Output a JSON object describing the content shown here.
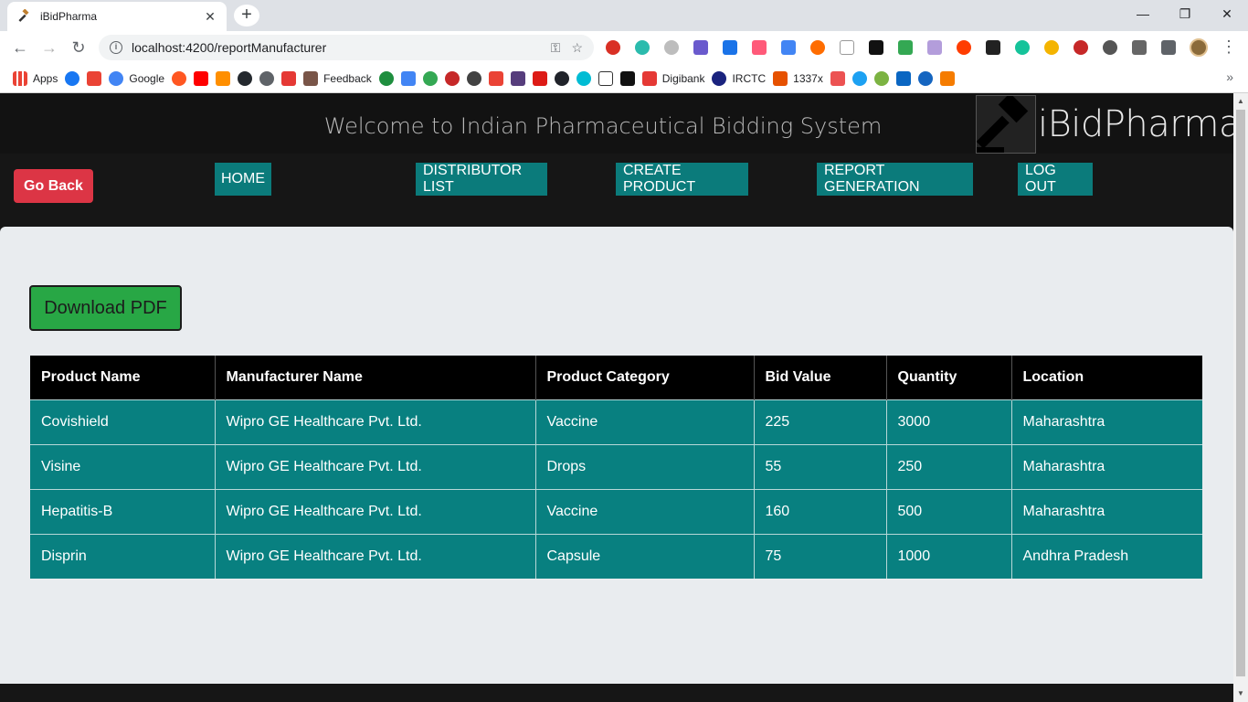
{
  "browser": {
    "tab_title": "iBidPharma",
    "url": "localhost:4200/reportManufacturer",
    "bookmarks": [
      "Apps",
      "Google",
      "Feedback",
      "Digibank",
      "IRCTC",
      "1337x"
    ]
  },
  "header": {
    "welcome": "Welcome to Indian Pharmaceutical Bidding System",
    "brand": "iBidPharma"
  },
  "nav": {
    "go_back": "Go Back",
    "links": [
      "HOME",
      "DISTRIBUTOR LIST",
      "CREATE PRODUCT",
      "REPORT GENERATION",
      "LOG OUT"
    ]
  },
  "main": {
    "download_pdf": "Download PDF",
    "table": {
      "headers": [
        "Product Name",
        "Manufacturer Name",
        "Product Category",
        "Bid Value",
        "Quantity",
        "Location"
      ],
      "rows": [
        [
          "Covishield",
          "Wipro GE Healthcare Pvt. Ltd.",
          "Vaccine",
          "225",
          "3000",
          "Maharashtra"
        ],
        [
          "Visine",
          "Wipro GE Healthcare Pvt. Ltd.",
          "Drops",
          "55",
          "250",
          "Maharashtra"
        ],
        [
          "Hepatitis-B",
          "Wipro GE Healthcare Pvt. Ltd.",
          "Vaccine",
          "160",
          "500",
          "Maharashtra"
        ],
        [
          "Disprin",
          "Wipro GE Healthcare Pvt. Ltd.",
          "Capsule",
          "75",
          "1000",
          "Andhra Pradesh"
        ]
      ]
    }
  },
  "colors": {
    "nav_teal": "#0b7b7b",
    "row_teal": "#088080",
    "go_back_red": "#dc3545",
    "pdf_green": "#28a745"
  }
}
